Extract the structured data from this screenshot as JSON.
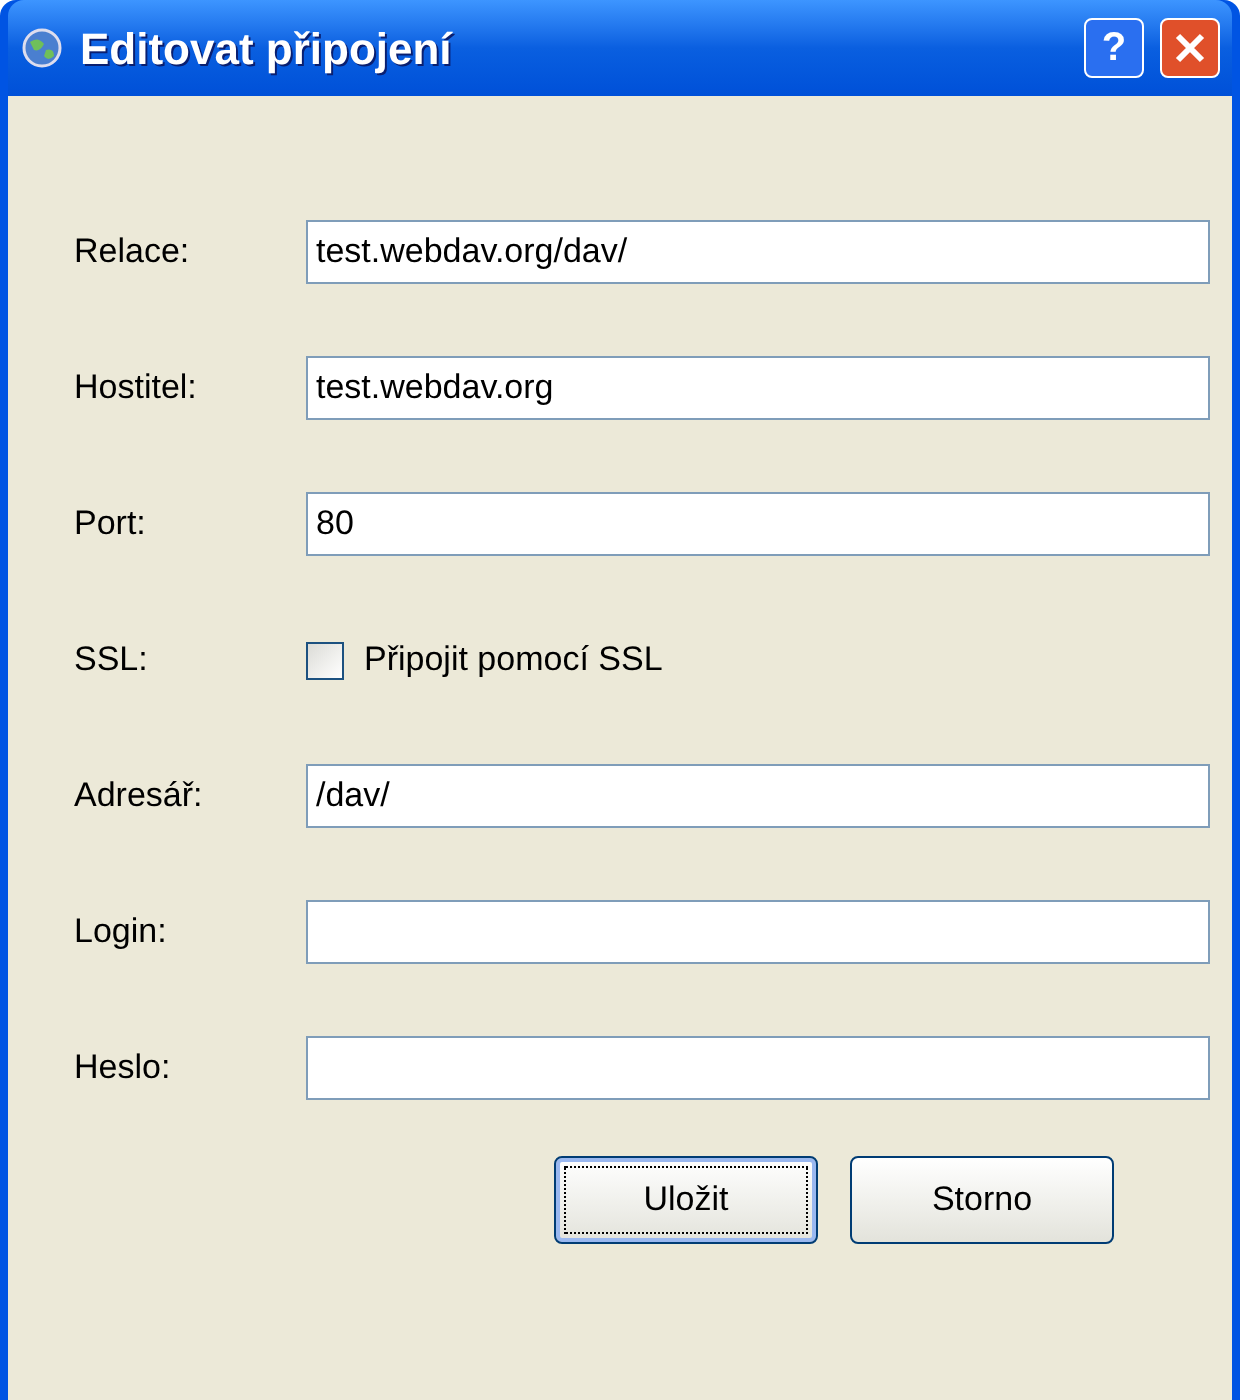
{
  "window": {
    "title": "Editovat připojení",
    "help": "?"
  },
  "fields": [
    {
      "kind": "text",
      "label": "Relace:",
      "value": "test.webdav.org/dav/"
    },
    {
      "kind": "text",
      "label": "Hostitel:",
      "value": "test.webdav.org"
    },
    {
      "kind": "text",
      "label": "Port:",
      "value": "80"
    },
    {
      "kind": "checkbox",
      "label": "SSL:",
      "text": "Připojit pomocí SSL",
      "checked": false
    },
    {
      "kind": "text",
      "label": "Adresář:",
      "value": "/dav/"
    },
    {
      "kind": "text",
      "label": "Login:"
    },
    {
      "kind": "text",
      "label": "Heslo:"
    }
  ],
  "buttons": [
    {
      "label": "Uložit",
      "default": true
    },
    {
      "label": "Storno",
      "default": false
    }
  ]
}
